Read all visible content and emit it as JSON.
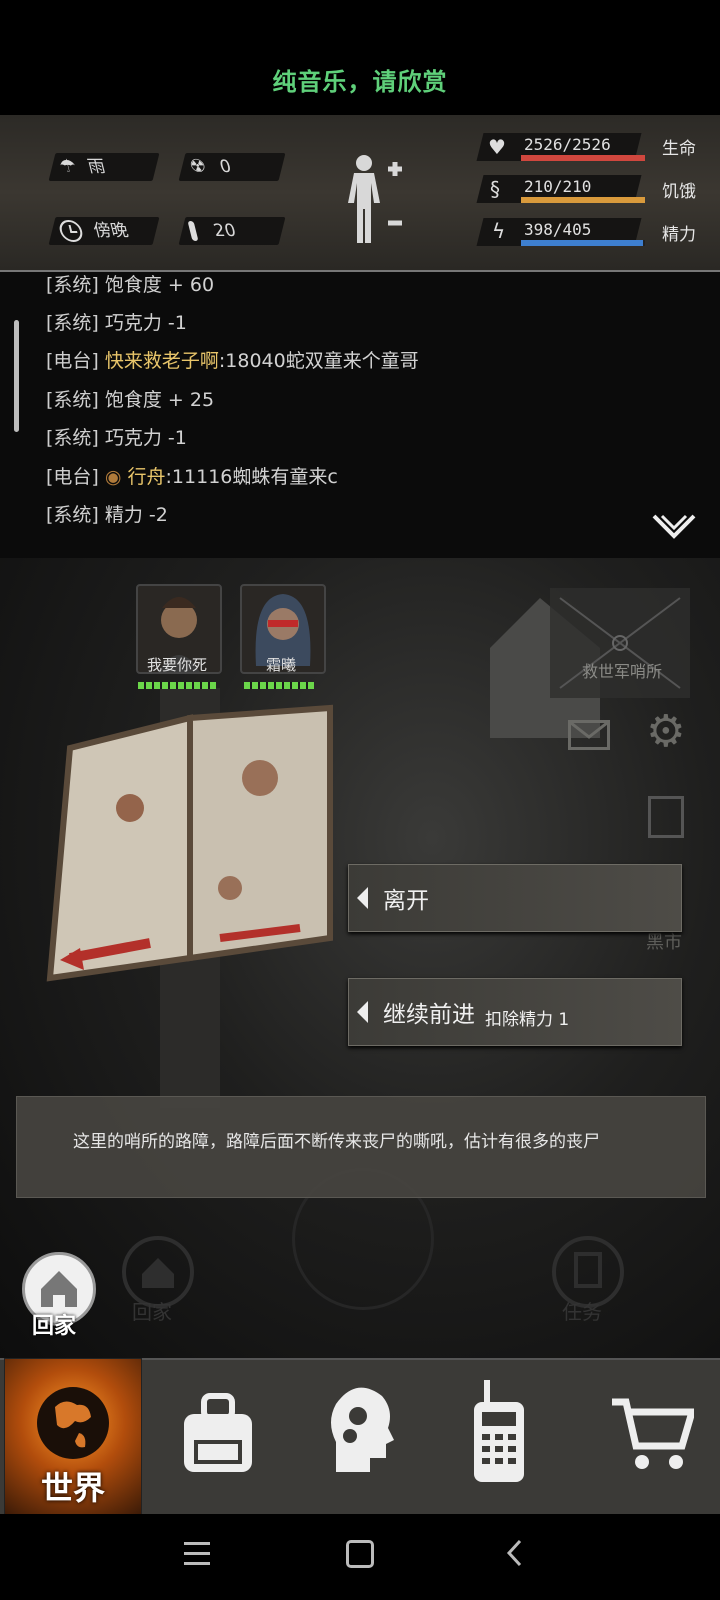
{
  "music": "纯音乐，请欣赏",
  "status": {
    "weather": "雨",
    "radiation": "0",
    "time_of_day": "傍晚",
    "temperature": "20",
    "health_value": "2526/2526",
    "health_label": "生命",
    "health_fraction": 1.0,
    "hunger_value": "210/210",
    "hunger_label": "饥饿",
    "hunger_fraction": 1.0,
    "energy_value": "398/405",
    "energy_label": "精力",
    "energy_fraction": 0.983,
    "colors": {
      "health": "#d0473e",
      "hunger": "#d99a3c",
      "energy": "#3e7fd0"
    }
  },
  "log": [
    {
      "tag": "[系统]",
      "text": "饱食度 + 60",
      "type": "system"
    },
    {
      "tag": "[系统]",
      "text": "巧克力 -1",
      "type": "system"
    },
    {
      "tag": "[电台]",
      "name": "快来救老子啊",
      "text": ":18040蛇双童来个童哥",
      "type": "radio"
    },
    {
      "tag": "[系统]",
      "text": "饱食度 + 25",
      "type": "system"
    },
    {
      "tag": "[系统]",
      "text": "巧克力 -1",
      "type": "system"
    },
    {
      "tag": "[电台]",
      "name": "行舟",
      "text": ":11116蜘蛛有童来c",
      "type": "radio"
    },
    {
      "tag": "[系统]",
      "text": "精力 -2",
      "type": "system"
    }
  ],
  "party": [
    {
      "name": "我要你死",
      "hp_fraction": 1.0
    },
    {
      "name": "霜曦",
      "hp_fraction": 0.9
    }
  ],
  "scene": {
    "location": "救世军哨所",
    "black_market": "黑市"
  },
  "choices": [
    {
      "label": "离开",
      "sub": ""
    },
    {
      "label": "继续前进",
      "sub": "扣除精力 1"
    }
  ],
  "description": "这里的哨所的路障，路障后面不断传来丧尸的嘶吼，估计有很多的丧尸",
  "shortcuts": {
    "home": "回家",
    "home_ghost": "回家",
    "task": "任务"
  },
  "nav": {
    "world": "世界"
  }
}
